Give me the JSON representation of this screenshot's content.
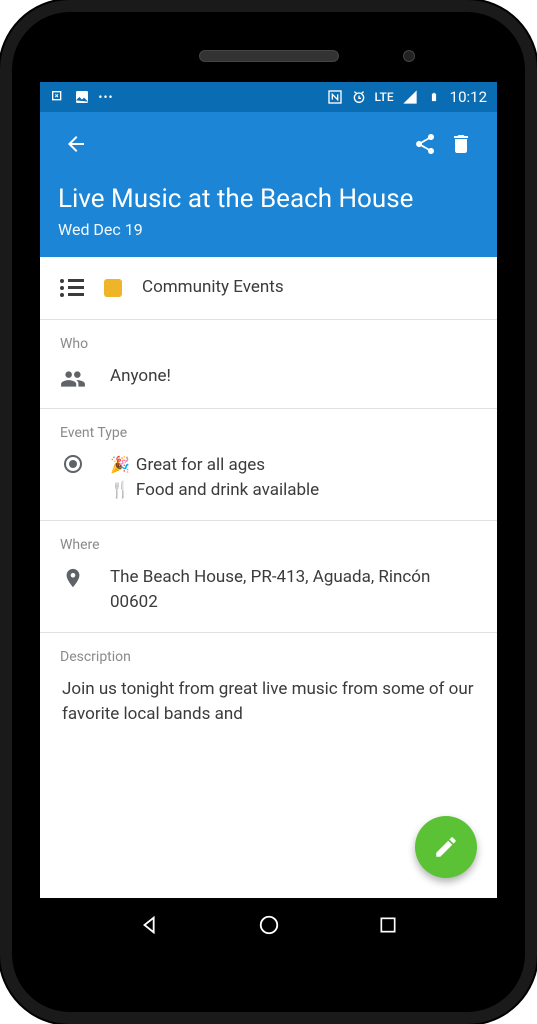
{
  "status": {
    "time": "10:12",
    "lte": "LTE"
  },
  "header": {
    "title": "Live Music at the Beach House",
    "date": "Wed Dec 19"
  },
  "category": {
    "label": "Community Events",
    "color": "#f0b429"
  },
  "who": {
    "heading": "Who",
    "value": "Anyone!"
  },
  "eventType": {
    "heading": "Event Type",
    "line1": "Great for all ages",
    "line2": "Food and drink available"
  },
  "where": {
    "heading": "Where",
    "value": "The Beach House, PR-413, Aguada, Rincón 00602"
  },
  "description": {
    "heading": "Description",
    "value": "Join us tonight from great live music from some of our favorite local bands and"
  }
}
